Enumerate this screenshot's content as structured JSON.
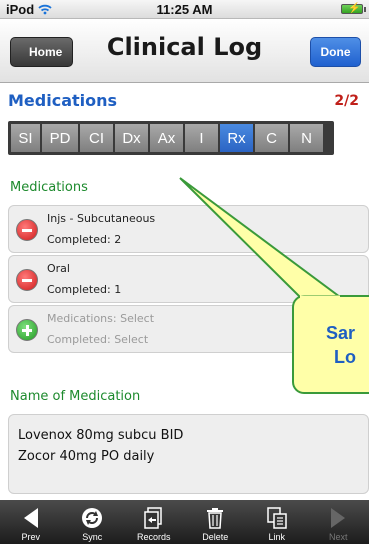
{
  "status_bar": {
    "carrier": "iPod",
    "time": "11:25 AM"
  },
  "nav": {
    "back_label": "Home",
    "title": "Clinical Log",
    "done_label": "Done"
  },
  "section": {
    "heading": "Medications",
    "page_count": "2/2"
  },
  "tabs": [
    {
      "label": "SI",
      "active": false
    },
    {
      "label": "PD",
      "active": false
    },
    {
      "label": "CI",
      "active": false
    },
    {
      "label": "Dx",
      "active": false
    },
    {
      "label": "Ax",
      "active": false
    },
    {
      "label": "I",
      "active": false
    },
    {
      "label": "Rx",
      "active": true
    },
    {
      "label": "C",
      "active": false
    },
    {
      "label": "N",
      "active": false
    }
  ],
  "medications": {
    "heading": "Medications",
    "items": [
      {
        "title": "Injs - Subcutaneous",
        "status": "Completed: 2",
        "action": "remove-icon"
      },
      {
        "title": "Oral",
        "status": "Completed: 1",
        "action": "remove-icon"
      },
      {
        "title": "Medications: Select",
        "status": "Completed: Select",
        "action": "add-icon"
      }
    ]
  },
  "name_of_medication": {
    "heading": "Name of Medication",
    "entries": [
      "Lovenox 80mg subcu BID",
      "Zocor 40mg PO daily"
    ]
  },
  "callout": {
    "line1": "Sar",
    "line2": "Lo"
  },
  "toolbar": {
    "items": [
      {
        "label": "Prev",
        "icon": "prev-arrow-icon",
        "enabled": true
      },
      {
        "label": "Sync",
        "icon": "sync-icon",
        "enabled": true
      },
      {
        "label": "Records",
        "icon": "records-icon",
        "enabled": true
      },
      {
        "label": "Delete",
        "icon": "trash-icon",
        "enabled": true
      },
      {
        "label": "Link",
        "icon": "link-icon",
        "enabled": true
      },
      {
        "label": "Next",
        "icon": "next-arrow-icon",
        "enabled": false
      }
    ]
  },
  "colors": {
    "heading_blue": "#1f5fc2",
    "page_count_red": "#c0201a",
    "section_green": "#1d8a2d",
    "active_tab": "#2b64c4",
    "callout_fill": "#ffffa8",
    "callout_border": "#3a9a3a"
  }
}
